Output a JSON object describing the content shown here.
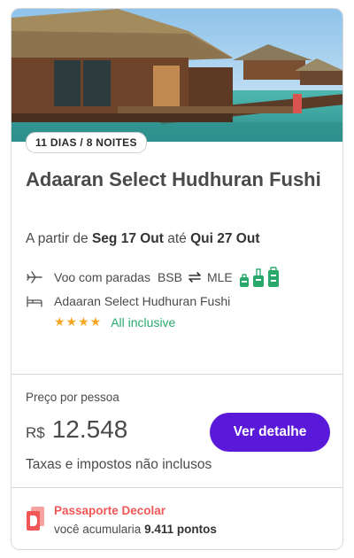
{
  "package": {
    "duration_badge": "11 DIAS / 8 NOITES",
    "title": "Adaaran Select Hudhuran Fushi",
    "dates": {
      "prefix": "A partir de",
      "start": "Seg 17 Out",
      "connector": "até",
      "end": "Qui 27 Out"
    },
    "flight": {
      "icon": "plane-icon",
      "label": "Voo com paradas",
      "origin": "BSB",
      "destination": "MLE",
      "swap_icon": "round-trip-arrows-icon",
      "bag_icons": [
        "personal-bag-icon",
        "carry-on-icon",
        "checked-bag-icon"
      ],
      "bag_color": "#2aa86b"
    },
    "hotel": {
      "icon": "bed-icon",
      "name": "Adaaran Select Hudhuran Fushi",
      "stars": 4,
      "stars_text": "★★★★",
      "plan": "All inclusive"
    }
  },
  "pricing": {
    "label": "Preço por pessoa",
    "currency": "R$",
    "amount": "12.548",
    "button_label": "Ver detalhe",
    "taxes_note": "Taxas e impostos não inclusos"
  },
  "loyalty": {
    "icon": "passaporte-logo-icon",
    "title": "Passaporte Decolar",
    "text_prefix": "você acumularia",
    "points": "9.411 pontos"
  },
  "colors": {
    "accent": "#5a19d9",
    "stars": "#f5a623",
    "success": "#2aa86b",
    "loyalty": "#f25757"
  }
}
